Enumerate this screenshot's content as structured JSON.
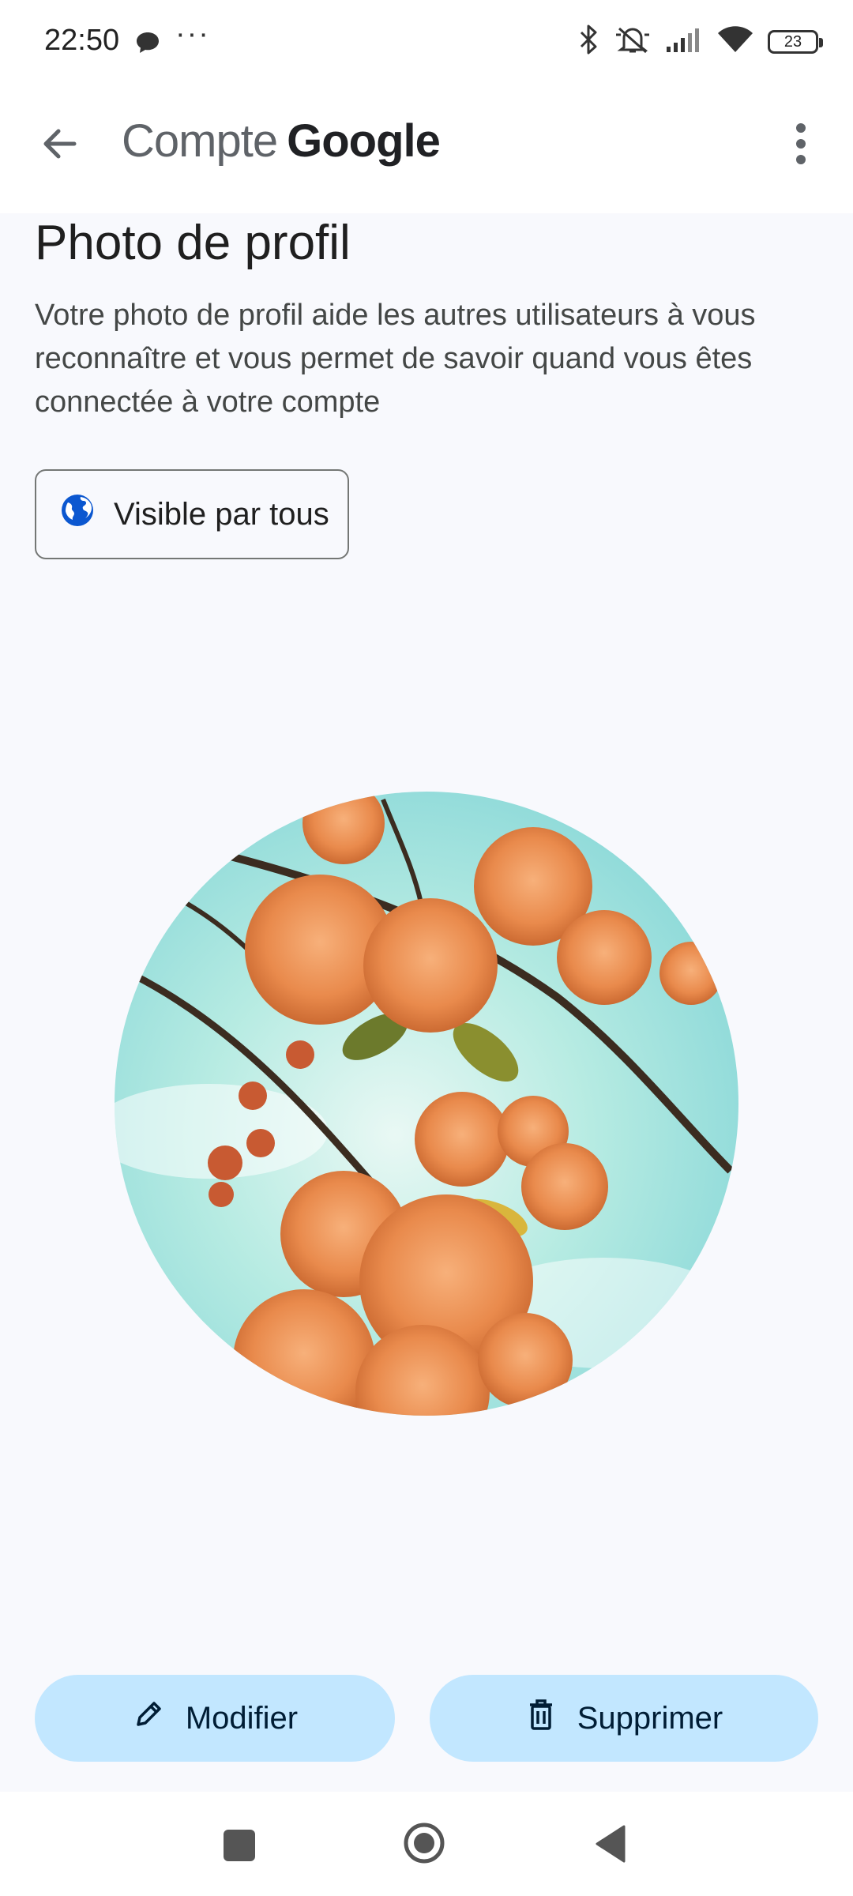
{
  "status_bar": {
    "time": "22:50",
    "more": "···",
    "battery": "23",
    "icons": [
      "chat-bubble-icon",
      "bluetooth-icon",
      "silent-icon",
      "signal-icon",
      "wifi-icon",
      "battery-icon"
    ]
  },
  "app_bar": {
    "brand_prefix": "Compte",
    "brand_name": "Google",
    "back_icon": "arrow-back-icon",
    "menu_icon": "more-vert-icon"
  },
  "page": {
    "title": "Photo de profil",
    "description": "Votre photo de profil aide les autres utilisateurs à vous reconnaître et vous permet de savoir quand vous êtes connectée à votre compte",
    "visibility_label": "Visible par tous"
  },
  "actions": {
    "edit_label": "Modifier",
    "delete_label": "Supprimer"
  },
  "colors": {
    "background": "#f8f9fd",
    "button_fill": "#c2e7ff",
    "globe_blue": "#0b57d0"
  }
}
